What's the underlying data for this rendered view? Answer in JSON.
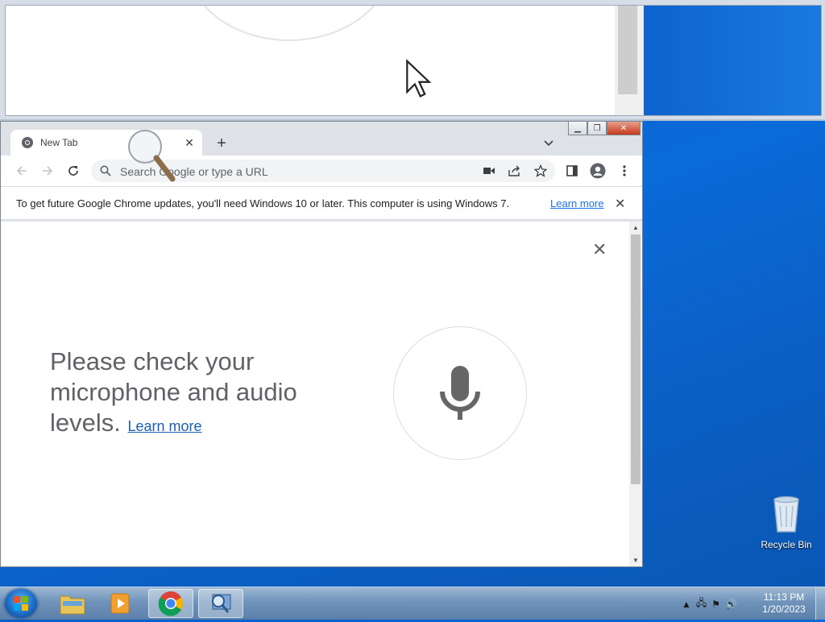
{
  "chrome": {
    "tab_title": "New Tab",
    "omnibox_placeholder": "Search Google or type a URL",
    "infobar_message": "To get future Google Chrome updates, you'll need Windows 10 or later. This computer is using Windows 7.",
    "infobar_link": "Learn more",
    "voice": {
      "message": "Please check your microphone and audio levels.",
      "link": "Learn more"
    }
  },
  "desktop": {
    "recycle_bin_label": "Recycle Bin"
  },
  "taskbar": {
    "time": "11:13 PM",
    "date": "1/20/2023"
  },
  "icons": {
    "start": "windows-orb-icon",
    "explorer": "folder-icon",
    "media": "media-player-icon",
    "chrome": "chrome-icon",
    "magnifier": "magnifier-icon"
  },
  "colors": {
    "desktop_blue": "#0a5fc9",
    "chrome_frame": "#dee1e6",
    "link_blue": "#1a73e8",
    "text_gray": "#5f6368"
  }
}
